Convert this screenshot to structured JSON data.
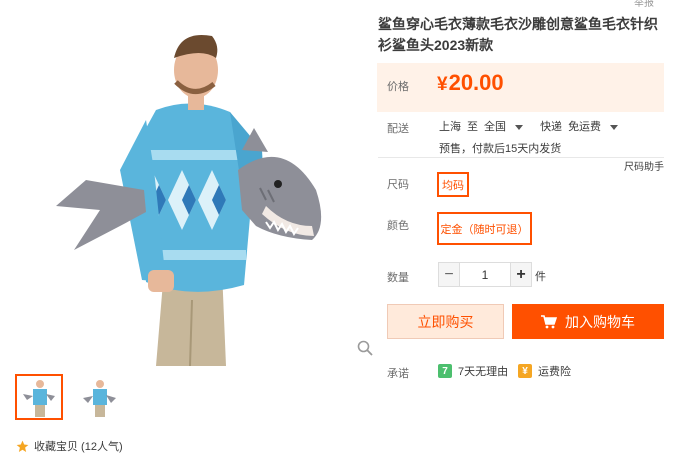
{
  "product": {
    "title": "鲨鱼穿心毛衣薄款毛衣沙雕创意鲨鱼毛衣针织衫鲨鱼头2023新款",
    "report_label": "举报",
    "price_label": "价格",
    "currency": "¥",
    "price": "20.00"
  },
  "shipping": {
    "label": "配送",
    "from": "上海",
    "to_word": "至",
    "to": "全国",
    "method": "快递",
    "fee": "免运费",
    "note": "预售，付款后15天内发货"
  },
  "options": {
    "size_helper": "尺码助手",
    "size_label": "尺码",
    "size_value": "均码",
    "color_label": "颜色",
    "color_value": "定金（随时可退）"
  },
  "quantity": {
    "label": "数量",
    "minus": "−",
    "value": "1",
    "plus": "+",
    "unit": "件"
  },
  "actions": {
    "buy_now": "立即购买",
    "add_to_cart": "加入购物车"
  },
  "promises": {
    "label": "承诺",
    "items": [
      {
        "icon": "7",
        "text": "7天无理由"
      },
      {
        "icon": "¥",
        "text": "运费险"
      }
    ]
  },
  "favorite": {
    "text": "收藏宝贝 (12人气)"
  },
  "colors": {
    "accent": "#ff5000",
    "price_bg": "#fff2e8",
    "sweater": "#5ab5dc",
    "shark": "#8e8f98"
  }
}
